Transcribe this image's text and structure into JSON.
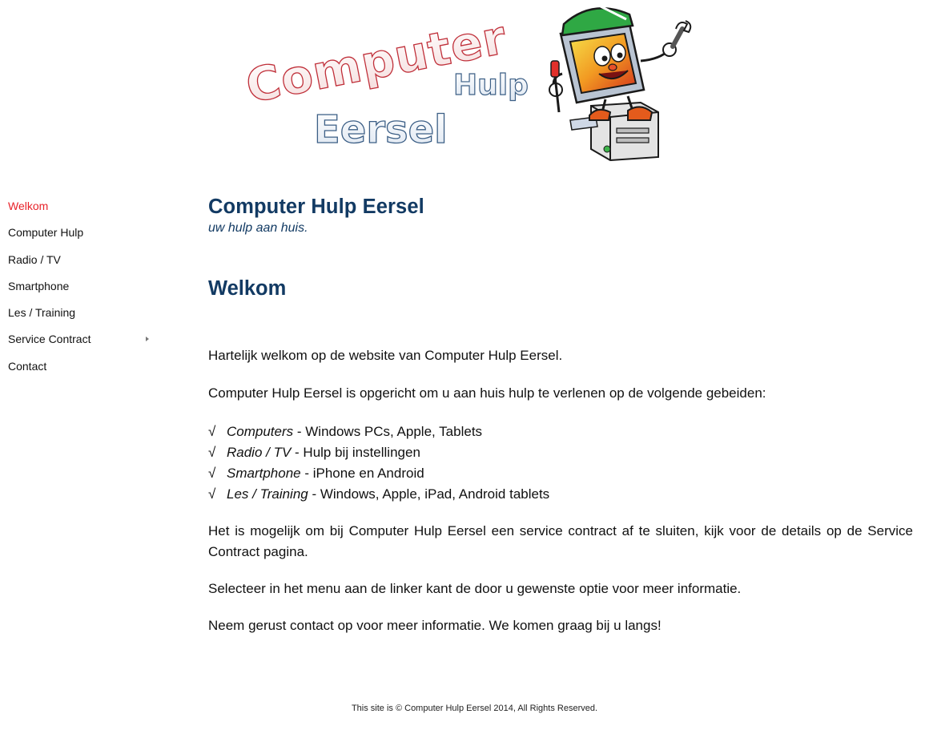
{
  "logo": {
    "word1": "Computer",
    "word2": "Hulp",
    "word3": "Eersel"
  },
  "sidebar": {
    "items": [
      {
        "label": "Welkom",
        "active": true
      },
      {
        "label": "Computer Hulp"
      },
      {
        "label": "Radio / TV"
      },
      {
        "label": "Smartphone"
      },
      {
        "label": "Les / Training"
      },
      {
        "label": "Service Contract",
        "has_submenu": true
      },
      {
        "label": "Contact"
      }
    ]
  },
  "header": {
    "title": "Computer Hulp Eersel",
    "tagline": "uw hulp aan huis."
  },
  "main": {
    "heading": "Welkom",
    "intro": "Hartelijk welkom op de website van Computer Hulp Eersel.",
    "purpose": "Computer Hulp Eersel is opgericht om u aan huis hulp te verlenen op de volgende gebeiden:",
    "check_symbol": "√",
    "services": [
      {
        "name": "Computers",
        "desc": " - Windows PCs, Apple, Tablets"
      },
      {
        "name": "Radio / TV",
        "desc": " - Hulp bij instellingen"
      },
      {
        "name": "Smartphone",
        "desc": " - iPhone en Android"
      },
      {
        "name": "Les / Training",
        "desc": " - Windows, Apple, iPad, Android tablets"
      }
    ],
    "contract": "Het is mogelijk om bij Computer Hulp Eersel een service contract af te sluiten, kijk voor de details op de Service Contract pagina.",
    "select": "Selecteer in het menu aan de linker kant de door u gewenste optie voor meer informatie.",
    "contact": "Neem gerust contact op voor meer informatie. We komen graag bij u langs!"
  },
  "footer": {
    "text": "This site is © Computer Hulp Eersel 2014, All Rights Reserved."
  },
  "colors": {
    "accent_active": "#e8232a",
    "heading": "#123a63",
    "logo_red": "#c0303a",
    "logo_blue": "#3c5f86"
  },
  "icons": {
    "submenu": "chevron-right-icon",
    "mascot": "computer-mascot-icon"
  }
}
